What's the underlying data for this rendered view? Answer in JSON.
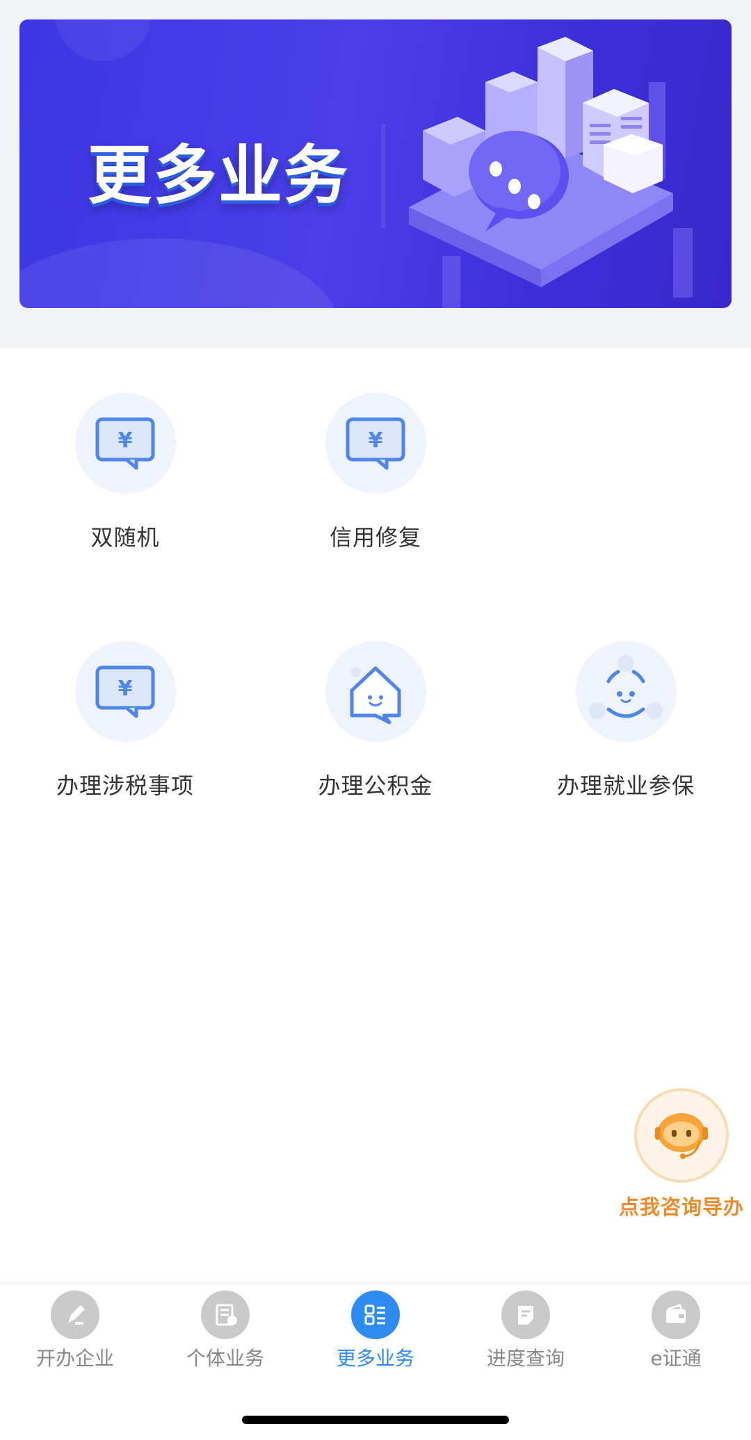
{
  "banner": {
    "title": "更多业务"
  },
  "services": [
    {
      "label": "双随机",
      "icon": "yen-chat-icon"
    },
    {
      "label": "信用修复",
      "icon": "yen-chat-icon"
    },
    {
      "label": "办理涉税事项",
      "icon": "yen-chat-icon"
    },
    {
      "label": "办理公积金",
      "icon": "house-smile-icon"
    },
    {
      "label": "办理就业参保",
      "icon": "smile-face-icon"
    }
  ],
  "assistant": {
    "label": "点我咨询导办",
    "icon": "robot-headset-icon"
  },
  "tabbar": {
    "active_index": 2,
    "items": [
      {
        "label": "开办企业",
        "icon": "pen-edit-icon"
      },
      {
        "label": "个体业务",
        "icon": "document-icon"
      },
      {
        "label": "更多业务",
        "icon": "grid-list-icon"
      },
      {
        "label": "进度查询",
        "icon": "note-icon"
      },
      {
        "label": "e证通",
        "icon": "wallet-icon"
      }
    ]
  },
  "colors": {
    "accent": "#2e8cf0",
    "banner": "#4a3fe8",
    "assistant": "#f08a2a",
    "icon_blue": "#4f86ec"
  }
}
